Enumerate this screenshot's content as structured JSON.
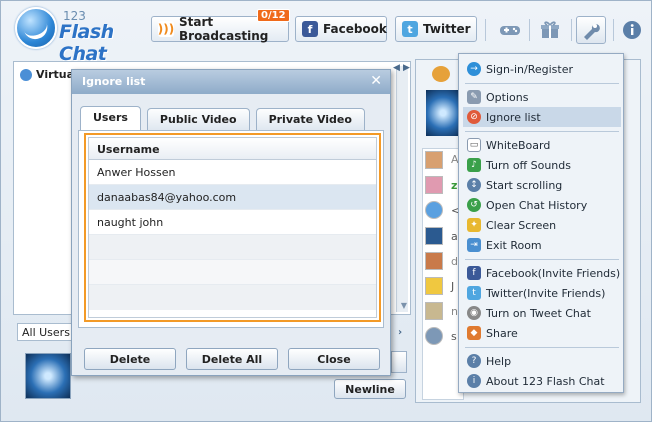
{
  "logo": {
    "number": "123",
    "name": "Flash Chat"
  },
  "toolbar": {
    "broadcast_label": "Start Broadcasting",
    "broadcast_badge": "0/12",
    "facebook_label": "Facebook",
    "twitter_label": "Twitter"
  },
  "left_panel": {
    "room_label": "Virtual",
    "room_select": "All Users",
    "newline_label": "Newline"
  },
  "right_panel": {
    "letters": [
      "A",
      "z",
      "<",
      "a",
      "d",
      "J",
      "n",
      "s"
    ]
  },
  "dialog": {
    "title": "Ignore list",
    "tabs": [
      "Users",
      "Public Video",
      "Private Video"
    ],
    "column_header": "Username",
    "rows": [
      "Anwer Hossen",
      "danaabas84@yahoo.com",
      "naught john"
    ],
    "buttons": {
      "delete": "Delete",
      "delete_all": "Delete All",
      "close": "Close"
    }
  },
  "menu": {
    "items": [
      "Sign-in/Register",
      "Options",
      "Ignore list",
      "WhiteBoard",
      "Turn off Sounds",
      "Start scrolling",
      "Open Chat History",
      "Clear Screen",
      "Exit Room",
      "Facebook(Invite Friends)",
      "Twitter(Invite Friends)",
      "Turn on Tweet Chat",
      "Share",
      "Help",
      "About 123 Flash Chat"
    ]
  },
  "colors": {
    "accent": "#f39a27",
    "brand": "#2d73c6",
    "facebook": "#3b5998",
    "twitter": "#4fa6e0"
  }
}
